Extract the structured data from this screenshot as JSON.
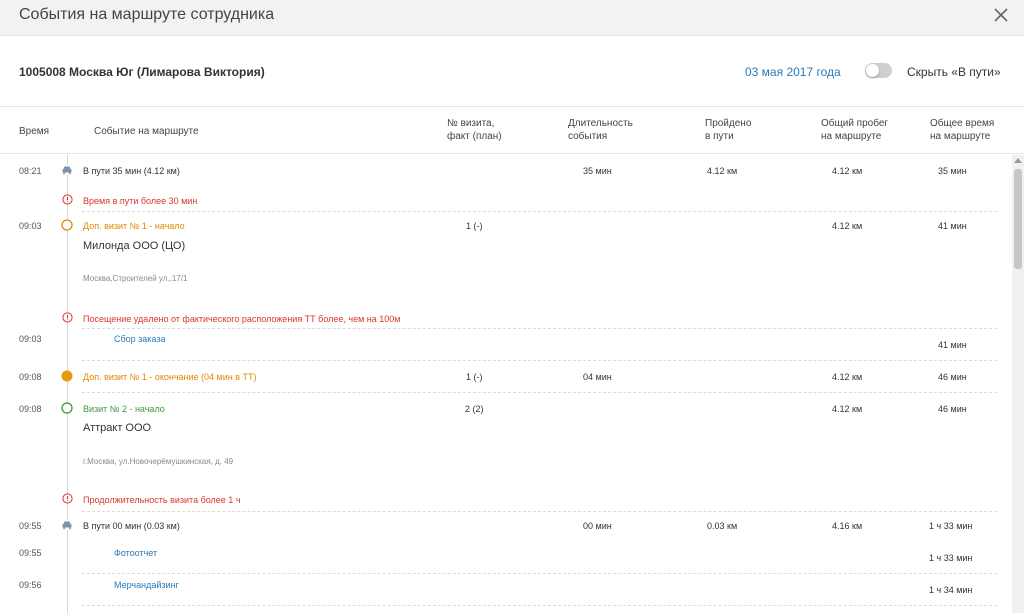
{
  "dialog": {
    "title": "События на маршруте сотрудника"
  },
  "summary": {
    "employee": "1005008 Москва Юг (Лимарова Виктория)",
    "date": "03 мая 2017 года",
    "hide_label": "Скрыть «В пути»"
  },
  "columns": {
    "time": "Время",
    "event": "Событие на маршруте",
    "visit_1": "№ визита,",
    "visit_2": "факт (план)",
    "duration_1": "Длительность",
    "duration_2": "события",
    "passed_1": "Пройдено",
    "passed_2": "в пути",
    "mileage_1": "Общий пробег",
    "mileage_2": "на маршруте",
    "total_1": "Общее время",
    "total_2": "на маршруте"
  },
  "rows": {
    "r1": {
      "time": "08:21",
      "event": "В пути 35 мин (4.12 км)",
      "duration": "35 мин",
      "passed": "4.12 км",
      "mileage": "4.12 км",
      "total": "35 мин"
    },
    "w1": {
      "text": "Время в пути более 30 мин"
    },
    "r2": {
      "time": "09:03",
      "event": "Доп. визит № 1 - начало",
      "visit": "1 (-)",
      "mileage": "4.12 км",
      "total": "41 мин",
      "name": "Милонда ООО (ЦО)",
      "address": "Москва,Строителей ул.,17/1"
    },
    "w2": {
      "text": "Посещение удалено от фактического расположения ТТ более, чем на 100м"
    },
    "r3": {
      "time": "09:03",
      "event": "Сбор заказа",
      "total": "41 мин"
    },
    "r4": {
      "time": "09:08",
      "event": "Доп. визит № 1 - окончание (04 мин в ТТ)",
      "visit": "1 (-)",
      "duration": "04 мин",
      "mileage": "4.12 км",
      "total": "46 мин"
    },
    "r5": {
      "time": "09:08",
      "event": "Визит № 2 - начало",
      "visit": "2 (2)",
      "mileage": "4.12 км",
      "total": "46 мин",
      "name": "Аттракт ООО",
      "address": "г.Москва, ул.Новочерёмушкинская, д. 49"
    },
    "w3": {
      "text": "Продолжительность визита более 1 ч"
    },
    "r6": {
      "time": "09:55",
      "event": "В пути 00 мин (0.03 км)",
      "duration": "00 мин",
      "passed": "0.03 км",
      "mileage": "4.16 км",
      "total": "1 ч 33 мин"
    },
    "r7": {
      "time": "09:55",
      "event": "Фотоотчет",
      "total": "1 ч 33 мин"
    },
    "r8": {
      "time": "09:56",
      "event": "Мерчандайзинг",
      "total": "1 ч 34 мин"
    }
  },
  "colors": {
    "warning": "#d9362b",
    "extra_visit": "#e08a00",
    "visit": "#3b9a3b",
    "link": "#2a79b7"
  }
}
